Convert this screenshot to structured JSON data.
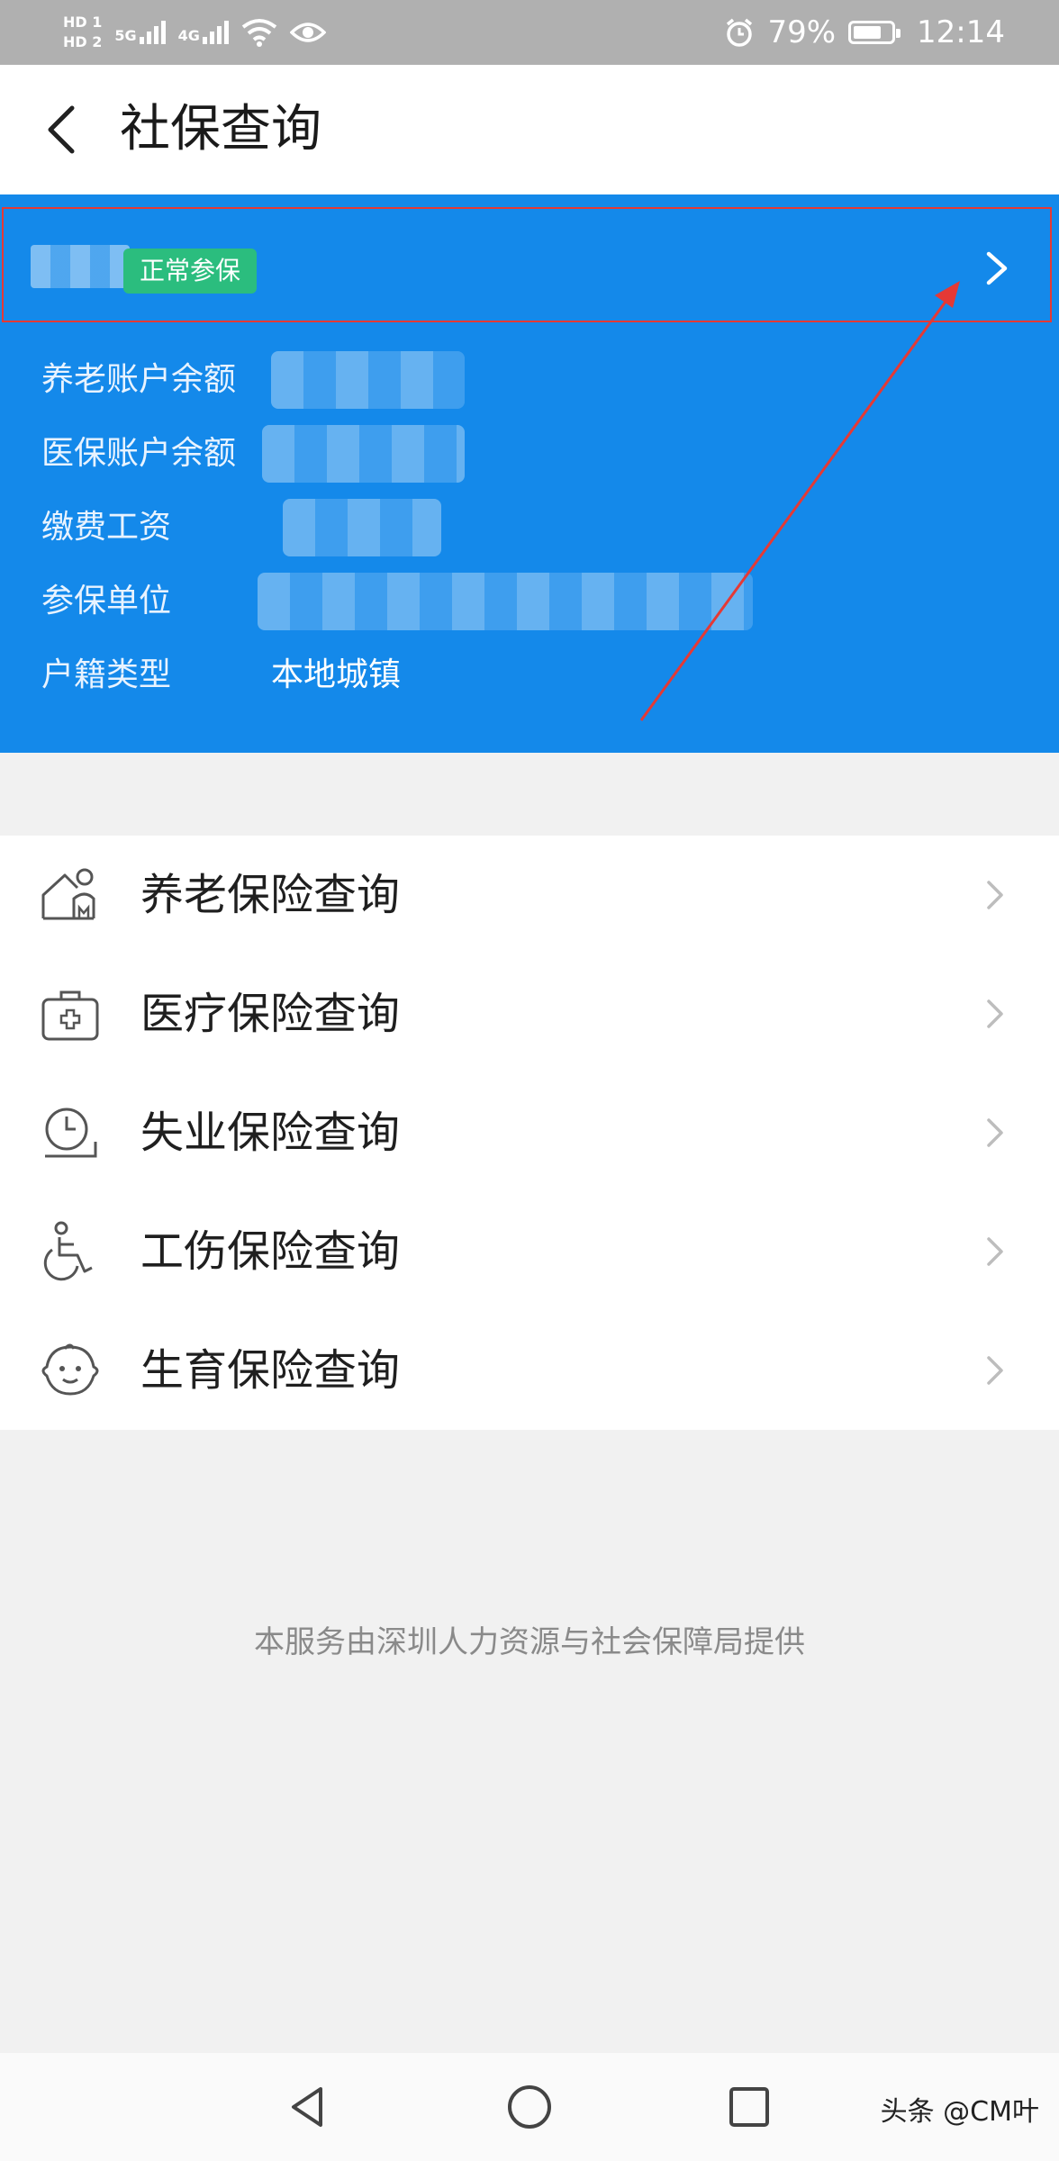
{
  "status_bar": {
    "hd1": "HD 1",
    "hd2": "HD 2",
    "net1": "5G",
    "net2": "4G",
    "battery_percent_text": "79%",
    "battery_level": 0.79,
    "time": "12:14"
  },
  "header": {
    "title": "社保查询"
  },
  "summary": {
    "status_badge": "正常参保",
    "rows": [
      {
        "label": "养老账户余额",
        "value": ""
      },
      {
        "label": "医保账户余额",
        "value": ""
      },
      {
        "label": "缴费工资",
        "value": ""
      },
      {
        "label": "参保单位",
        "value": ""
      },
      {
        "label": "户籍类型",
        "value": "本地城镇"
      }
    ]
  },
  "menu": {
    "items": [
      {
        "label": "养老保险查询",
        "icon": "elderly-house-icon"
      },
      {
        "label": "医疗保险查询",
        "icon": "medical-kit-icon"
      },
      {
        "label": "失业保险查询",
        "icon": "clock-icon"
      },
      {
        "label": "工伤保险查询",
        "icon": "wheelchair-icon"
      },
      {
        "label": "生育保险查询",
        "icon": "baby-face-icon"
      }
    ]
  },
  "footer": {
    "text": "本服务由深圳人力资源与社会保障局提供"
  },
  "watermark": {
    "text": "头条 @CM叶"
  },
  "colors": {
    "primary_blue": "#1489ea",
    "badge_green": "#2bbd7e",
    "annotation_red": "#e53935"
  }
}
